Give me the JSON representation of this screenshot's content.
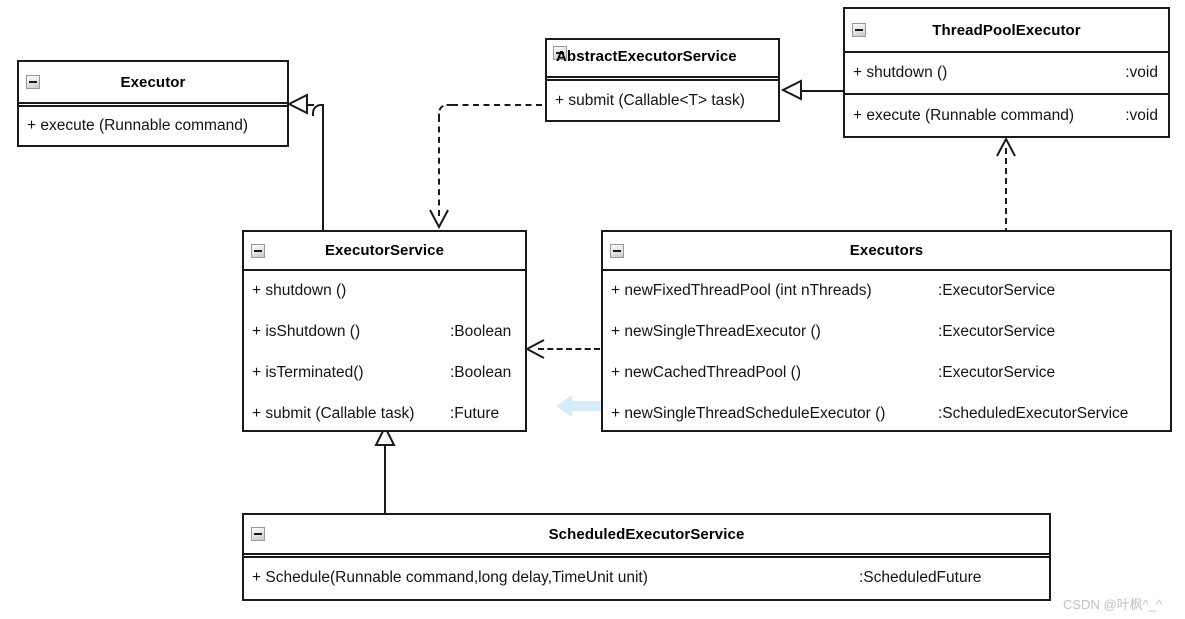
{
  "diagram": {
    "title": "Java Executor Framework UML class diagram",
    "collapse_icon_name": "minus-box-icon"
  },
  "classes": {
    "executor": {
      "name": "Executor",
      "methods": [
        {
          "signature": "+ execute (Runnable command)",
          "return": ""
        }
      ]
    },
    "abstract_executor_service": {
      "name": "AbstractExecutorService",
      "methods": [
        {
          "signature": "+ submit (Callable<T> task)",
          "return": ""
        }
      ]
    },
    "thread_pool_executor": {
      "name": "ThreadPoolExecutor",
      "methods": [
        {
          "signature": "+ shutdown ()",
          "return": ":void"
        },
        {
          "signature": "+ execute (Runnable command)",
          "return": ":void"
        }
      ]
    },
    "executor_service": {
      "name": "ExecutorService",
      "methods": [
        {
          "signature": "+ shutdown ()",
          "return": ""
        },
        {
          "signature": "+ isShutdown ()",
          "return": ":Boolean"
        },
        {
          "signature": "+ isTerminated()",
          "return": ":Boolean"
        },
        {
          "signature": "+ submit (Callable task)",
          "return": ":Future"
        }
      ]
    },
    "executors": {
      "name": "Executors",
      "methods": [
        {
          "signature": "+ newFixedThreadPool (int nThreads)",
          "return": ":ExecutorService"
        },
        {
          "signature": "+ newSingleThreadExecutor ()",
          "return": ":ExecutorService"
        },
        {
          "signature": "+ newCachedThreadPool ()",
          "return": ":ExecutorService"
        },
        {
          "signature": "+ newSingleThreadScheduleExecutor ()",
          "return": ":ScheduledExecutorService"
        }
      ]
    },
    "scheduled_executor_service": {
      "name": "ScheduledExecutorService",
      "methods": [
        {
          "signature": "+ Schedule(Runnable command,long delay,TimeUnit unit)",
          "return": ":ScheduledFuture"
        }
      ]
    }
  },
  "connectors": [
    {
      "id": "executorservice-to-executor",
      "kind": "generalization",
      "from": "ExecutorService",
      "to": "Executor"
    },
    {
      "id": "threadpoolexecutor-to-abstractexecutorservice",
      "kind": "generalization",
      "from": "ThreadPoolExecutor",
      "to": "AbstractExecutorService"
    },
    {
      "id": "scheduledexecutorservice-to-executorservice",
      "kind": "generalization",
      "from": "ScheduledExecutorService",
      "to": "ExecutorService"
    },
    {
      "id": "abstractexecutorservice-to-executorservice",
      "kind": "realization",
      "from": "AbstractExecutorService",
      "to": "ExecutorService"
    },
    {
      "id": "executors-to-executorservice",
      "kind": "dependency",
      "from": "Executors",
      "to": "ExecutorService"
    },
    {
      "id": "executors-to-threadpoolexecutor",
      "kind": "dependency",
      "from": "Executors",
      "to": "ThreadPoolExecutor"
    }
  ],
  "annotation": {
    "blue_arrow_name": "blue-highlight-arrow",
    "color": "#d6ecf8"
  },
  "watermark": {
    "text": "CSDN @叶枫^_^"
  }
}
